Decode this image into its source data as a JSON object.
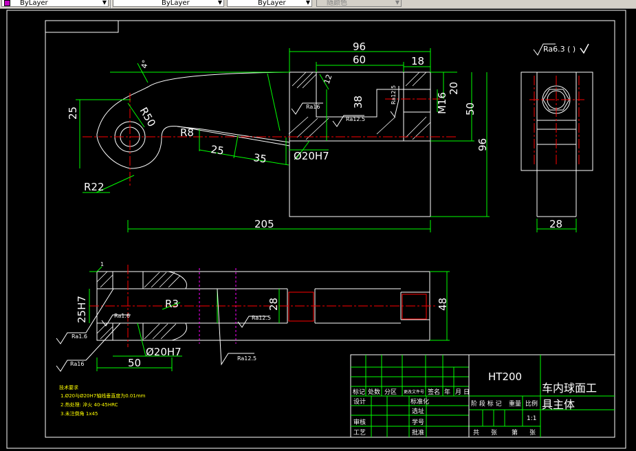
{
  "toolbar": {
    "color_combo": "ByLayer",
    "linetype_combo": "ByLayer",
    "lineweight_combo": "ByLayer",
    "plotstyle_combo": "随颜色"
  },
  "drawing": {
    "colors": {
      "line": "#ffffff",
      "dim": "#00ff00",
      "center": "#ff0000",
      "hidden": "#ff00ff",
      "frame": "#ffffff"
    },
    "dims": {
      "d96_top": "96",
      "d60": "60",
      "d18": "18",
      "d4deg": "4°",
      "d12": "12",
      "r50": "R50",
      "d25_left": "25",
      "r8": "R8",
      "d25_slot": "25",
      "d35": "35",
      "r22": "R22",
      "d38": "38",
      "d20": "20",
      "m16": "M16",
      "d50": "50",
      "d96_side": "96",
      "phi20h7_top": "Ø20H7",
      "d205": "205",
      "d28_side": "28",
      "d1": "1",
      "d25h7": "25H7",
      "r3": "R3",
      "d28_bottom": "28",
      "d48": "48",
      "phi20h7_bottom": "Ø20H7",
      "d50_bottom": "50"
    },
    "roughness": {
      "ra16_a": "Ra16",
      "ra125_a": "Ra12.5",
      "ra125_v": "Ra12.5",
      "ra63_global": "Ra6.3 (   )",
      "ra16_b": "Ra1.6",
      "ra16_c": "Ra1.6",
      "ra16_d": "Ra16",
      "ra125_b": "Ra12.5",
      "ra125_c": "Ra12.5"
    },
    "notes": {
      "title": "技术要求",
      "line1": "1.Ø20与Ø20H7轴线垂直度为0.01mm",
      "line2": "2.热处理: 淬火 40-45HRC",
      "line3": "3.未注倒角 1x45"
    },
    "titleblock": {
      "material": "HT200",
      "part_name_1": "车内球面工",
      "part_name_2": "具主体",
      "biaoji": "标记",
      "chushu": "处数",
      "fenqu": "分区",
      "gengai": "更改文件号",
      "qianming": "签名",
      "nian": "年",
      "yue": "月",
      "ri": "日",
      "sheji": "设计",
      "biaozhunhua": "标准化",
      "shenhe": "审核",
      "gongyi": "工艺",
      "jieduan": "阶 段 标 记",
      "zhongliang": "重量",
      "bili": "比例",
      "ratio": "1:1",
      "gong": "共",
      "zhang1": "张",
      "di": "第",
      "zhang2": "张",
      "xuanzhi": "选址",
      "xuhao": "学号",
      "pizhun": "批准"
    }
  }
}
